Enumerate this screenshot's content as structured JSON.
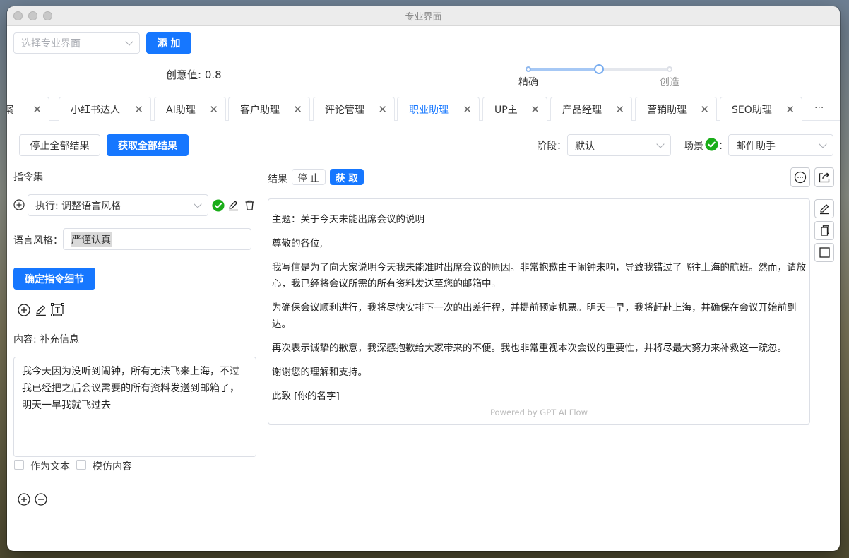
{
  "window": {
    "title": "专业界面"
  },
  "top": {
    "select_placeholder": "选择专业界面",
    "add_label": "添 加",
    "creativity_label": "创意值: 0.8",
    "creativity_value": 0.8,
    "slider_min_label": "精确",
    "slider_max_label": "创造"
  },
  "tabs": [
    {
      "label": "文案",
      "visible_label": "文案"
    },
    {
      "label": "小红书达人"
    },
    {
      "label": "AI助理"
    },
    {
      "label": "客户助理"
    },
    {
      "label": "评论管理"
    },
    {
      "label": "职业助理",
      "active": true
    },
    {
      "label": "UP主"
    },
    {
      "label": "产品经理"
    },
    {
      "label": "营销助理"
    },
    {
      "label": "SEO助理"
    }
  ],
  "tabs_more": "···",
  "toolbar": {
    "stop_all": "停止全部结果",
    "get_all": "获取全部结果",
    "stage_label": "阶段：",
    "stage_value": "默认",
    "scene_label": "场景",
    "scene_colon": "：",
    "scene_value": "邮件助手"
  },
  "left": {
    "instruction_set": "指令集",
    "exec_value": "执行: 调整语言风格",
    "style_label": "语言风格：",
    "style_value": "严谨认真",
    "confirm_button": "确定指令细节",
    "content_label": "内容: 补充信息",
    "content_text": "我今天因为没听到闹钟，所有无法飞来上海，不过我已经把之后会议需要的所有资料发送到邮箱了，明天一早我就飞过去",
    "as_text": "作为文本",
    "imitate": "模仿内容"
  },
  "result": {
    "label": "结果",
    "stop": "停 止",
    "get": "获 取",
    "paragraphs": [
      "主题：关于今天未能出席会议的说明",
      "尊敬的各位,",
      "我写信是为了向大家说明今天我未能准时出席会议的原因。非常抱歉由于闹钟未响，导致我错过了飞往上海的航班。然而，请放心，我已经将会议所需的所有资料发送至您的邮箱中。",
      "为确保会议顺利进行，我将尽快安排下一次的出差行程，并提前预定机票。明天一早，我将赶赴上海，并确保在会议开始前到达。",
      "再次表示诚挚的歉意，我深感抱歉给大家带来的不便。我也非常重视本次会议的重要性，并将尽最大努力来补救这一疏忽。",
      "谢谢您的理解和支持。",
      "此致 [你的名字]"
    ],
    "powered_by": "Powered by GPT AI Flow"
  },
  "colors": {
    "primary": "#1677ff",
    "success": "#1aad19"
  }
}
